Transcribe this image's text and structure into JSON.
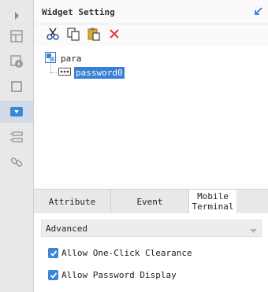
{
  "panel": {
    "title": "Widget Setting"
  },
  "toolbar": {
    "buttons": [
      {
        "icon": "cut-icon"
      },
      {
        "icon": "copy-icon"
      },
      {
        "icon": "paste-icon"
      },
      {
        "icon": "delete-icon"
      }
    ]
  },
  "tree": {
    "root_label": "para",
    "child_label": "password0"
  },
  "tabs": [
    {
      "label": "Attribute"
    },
    {
      "label": "Event"
    },
    {
      "label": "Mobile Terminal",
      "active": true
    }
  ],
  "settings": {
    "dropdown_label": "Advanced",
    "options": [
      {
        "label": "Allow One-Click Clearance",
        "checked": true
      },
      {
        "label": "Allow Password Display",
        "checked": true
      }
    ]
  },
  "colors": {
    "accent": "#3b86d8",
    "delete": "#e23b3b",
    "selection": "#3a7fd5"
  }
}
